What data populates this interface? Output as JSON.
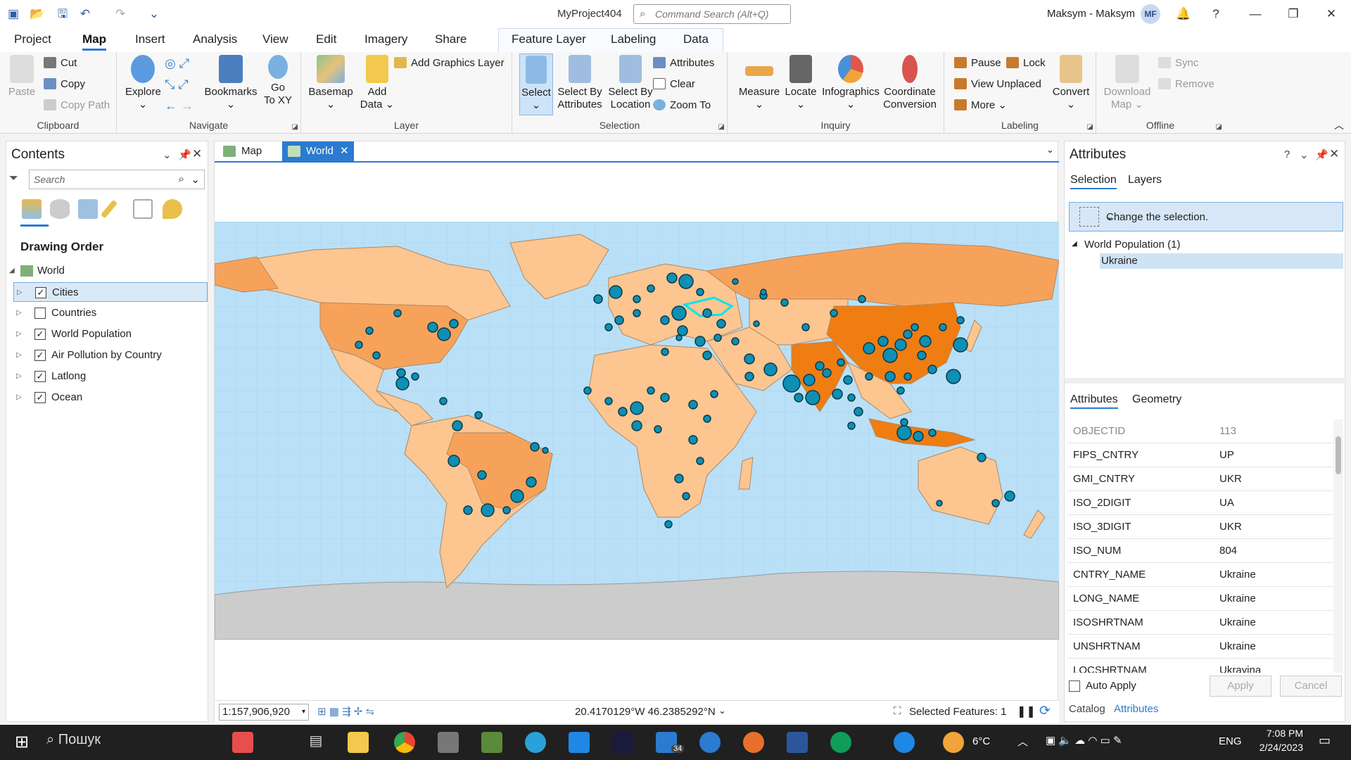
{
  "titlebar": {
    "title": "MyProject404",
    "command_search_placeholder": "Command Search (Alt+Q)",
    "user": "Maksym - Maksym",
    "avatar": "MF"
  },
  "ribbon_tabs": [
    "Project",
    "Map",
    "Insert",
    "Analysis",
    "View",
    "Edit",
    "Imagery",
    "Share",
    "Feature Layer",
    "Labeling",
    "Data"
  ],
  "ribbon": {
    "clipboard": {
      "label": "Clipboard",
      "paste": "Paste",
      "cut": "Cut",
      "copy": "Copy",
      "copy_path": "Copy Path"
    },
    "navigate": {
      "label": "Navigate",
      "explore": "Explore",
      "bookmarks": "Bookmarks",
      "go_to_xy_1": "Go",
      "go_to_xy_2": "To XY"
    },
    "layer": {
      "label": "Layer",
      "basemap": "Basemap",
      "add_data_1": "Add",
      "add_data_2": "Data",
      "add_graphics_layer": "Add Graphics Layer"
    },
    "selection": {
      "label": "Selection",
      "select": "Select",
      "select_by_attributes_1": "Select By",
      "select_by_attributes_2": "Attributes",
      "select_by_location_1": "Select By",
      "select_by_location_2": "Location",
      "attributes": "Attributes",
      "clear": "Clear",
      "zoom_to": "Zoom To"
    },
    "inquiry": {
      "label": "Inquiry",
      "measure": "Measure",
      "locate": "Locate",
      "infographics": "Infographics",
      "coordinate_conversion_1": "Coordinate",
      "coordinate_conversion_2": "Conversion"
    },
    "labeling": {
      "label": "Labeling",
      "pause": "Pause",
      "lock": "Lock",
      "view_unplaced": "View Unplaced",
      "more": "More",
      "convert": "Convert"
    },
    "offline": {
      "label": "Offline",
      "download_map_1": "Download",
      "download_map_2": "Map",
      "sync": "Sync",
      "remove": "Remove"
    }
  },
  "contents": {
    "title": "Contents",
    "search_placeholder": "Search",
    "drawing_order": "Drawing Order",
    "map_name": "World",
    "layers": [
      {
        "name": "Cities",
        "checked": true,
        "selected": true
      },
      {
        "name": "Countries",
        "checked": false,
        "selected": false
      },
      {
        "name": "World Population",
        "checked": true,
        "selected": false
      },
      {
        "name": "Air Pollution by Country",
        "checked": true,
        "selected": false
      },
      {
        "name": "Latlong",
        "checked": true,
        "selected": false
      },
      {
        "name": "Ocean",
        "checked": true,
        "selected": false
      }
    ]
  },
  "map_tabs": [
    {
      "name": "Map",
      "active": false
    },
    {
      "name": "World",
      "active": true
    }
  ],
  "map_status": {
    "scale": "1:157,906,920",
    "coordinates": "20.4170129°W 46.2385292°N",
    "selected_features": "Selected Features: 1"
  },
  "attributes_pane": {
    "title": "Attributes",
    "tabs": [
      "Selection",
      "Layers"
    ],
    "change_selection": "Change the selection.",
    "layer_group": "World Population  (1)",
    "selected_feature": "Ukraine",
    "detail_tabs": [
      "Attributes",
      "Geometry"
    ],
    "rows": [
      {
        "k": "OBJECTID",
        "v": "113"
      },
      {
        "k": "FIPS_CNTRY",
        "v": "UP"
      },
      {
        "k": "GMI_CNTRY",
        "v": "UKR"
      },
      {
        "k": "ISO_2DIGIT",
        "v": "UA"
      },
      {
        "k": "ISO_3DIGIT",
        "v": "UKR"
      },
      {
        "k": "ISO_NUM",
        "v": "804"
      },
      {
        "k": "CNTRY_NAME",
        "v": "Ukraine"
      },
      {
        "k": "LONG_NAME",
        "v": "Ukraine"
      },
      {
        "k": "ISOSHRTNAM",
        "v": "Ukraine"
      },
      {
        "k": "UNSHRTNAM",
        "v": "Ukraine"
      },
      {
        "k": "LOCSHRTNAM",
        "v": "Ukrayina"
      }
    ],
    "auto_apply": "Auto Apply",
    "apply": "Apply",
    "cancel": "Cancel",
    "bottom_tabs": [
      "Catalog",
      "Attributes"
    ]
  },
  "taskbar": {
    "search": "Пошук",
    "badge": "34",
    "temperature": "6°C",
    "language": "ENG",
    "time": "7:08 PM",
    "date": "2/24/2023"
  },
  "colors": {
    "accent": "#2b7bd0",
    "ocean": "#b9e0f7",
    "land": "#fdc590",
    "land_mid": "#f7a25b",
    "land_high": "#ef7d12",
    "city": "#0e8fb3",
    "antarctica": "#cccccc"
  }
}
